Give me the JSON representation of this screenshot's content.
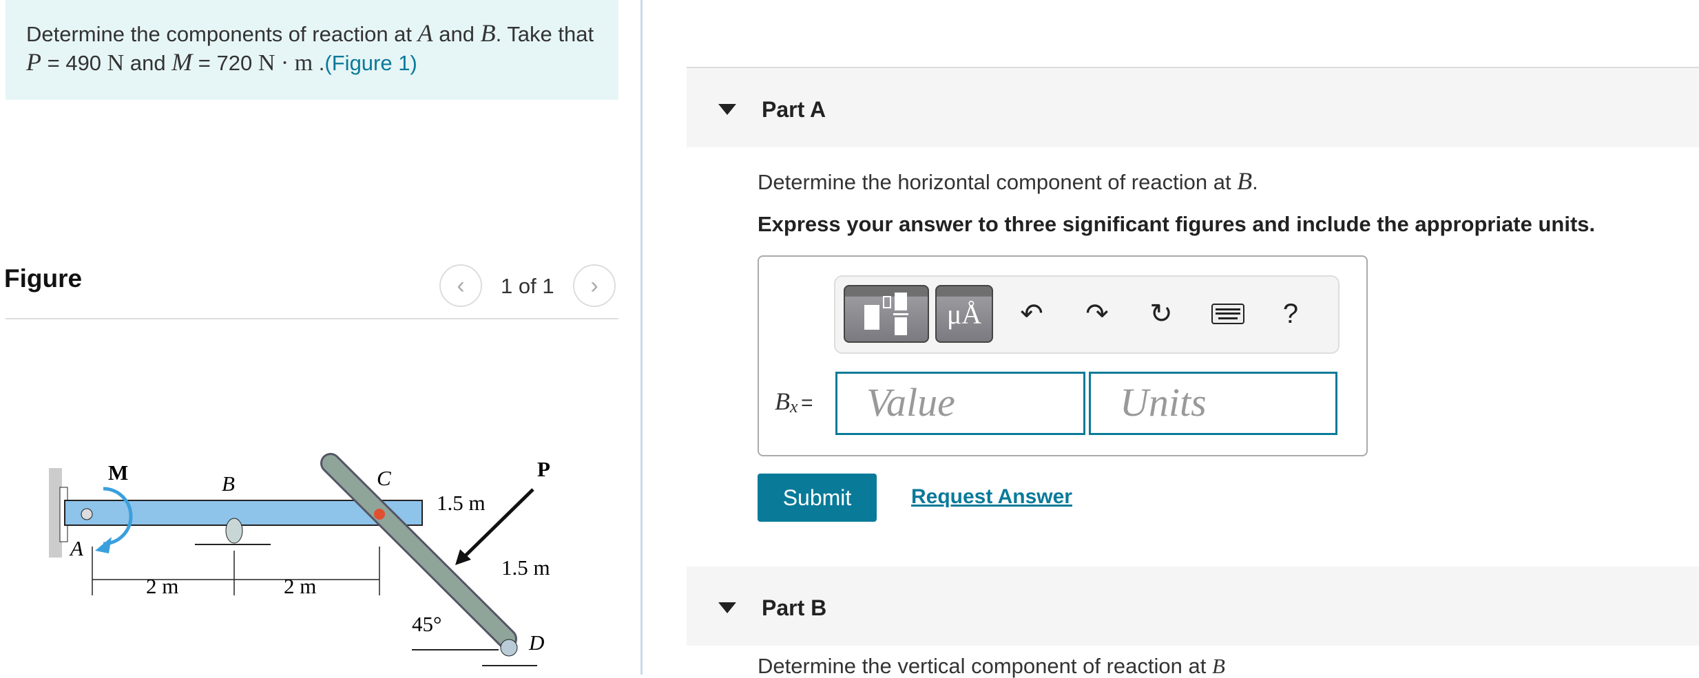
{
  "problem": {
    "text_1": "Determine the components of reaction at ",
    "var_a": "A",
    "text_2": " and ",
    "var_b": "B",
    "text_3": ". Take that ",
    "var_p": "P",
    "text_4": " = 490 ",
    "unit_n": "N",
    "text_5": " and ",
    "var_m": "M",
    "text_6": " = 720 ",
    "unit_nm": "N · m",
    "text_7": " .",
    "figure_link": "(Figure 1)"
  },
  "figure": {
    "title": "Figure",
    "prev_icon": "chevron-left",
    "next_icon": "chevron-right",
    "counter": "1 of 1",
    "labels": {
      "M": "M",
      "B": "B",
      "C": "C",
      "P": "P",
      "A": "A",
      "D": "D",
      "dim1": "2 m",
      "dim2": "2 m",
      "dim3": "1.5 m",
      "dim4": "1.5 m",
      "angle": "45°"
    }
  },
  "partA": {
    "title": "Part A",
    "question_prefix": "Determine the horizontal component of reaction at ",
    "question_var": "B",
    "question_suffix": ".",
    "instruction": "Express your answer to three significant figures and include the appropriate units.",
    "toolbar": {
      "templates_icon": "fraction-templates",
      "units_label": "μÅ",
      "undo_icon": "undo",
      "redo_icon": "redo",
      "reset_icon": "reset",
      "keyboard_icon": "keyboard",
      "help_label": "?"
    },
    "variable": "B",
    "subscript": "x",
    "equals": "=",
    "value_placeholder": "Value",
    "units_placeholder": "Units",
    "submit_label": "Submit",
    "request_answer_label": "Request Answer"
  },
  "partB": {
    "title": "Part B",
    "question_prefix": "Determine the vertical component of reaction at ",
    "question_var": "B"
  },
  "colors": {
    "accent": "#0a7a99",
    "problem_bg": "#e6f5f6",
    "part_band": "#f5f5f5"
  }
}
